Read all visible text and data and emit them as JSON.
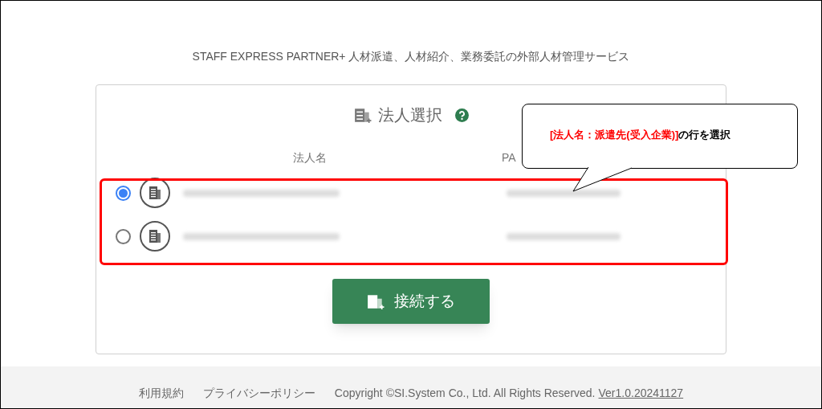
{
  "tagline": "STAFF EXPRESS PARTNER+ 人材派遣、人材紹介、業務委託の外部人材管理サービス",
  "card": {
    "title": "法人選択",
    "columns": [
      "法人名",
      "PA"
    ],
    "rows": [
      {
        "selected": true
      },
      {
        "selected": false
      }
    ],
    "connect_button": "接続する"
  },
  "callout": {
    "highlight": "[法人名：派遣先(受入企業)]",
    "text": "の行を選択"
  },
  "footer": {
    "links": [
      "利用規約",
      "プライバシーポリシー"
    ],
    "copyright": "Copyright ©SI.System Co., Ltd. All Rights Reserved.",
    "version": "Ver1.0.20241127"
  }
}
